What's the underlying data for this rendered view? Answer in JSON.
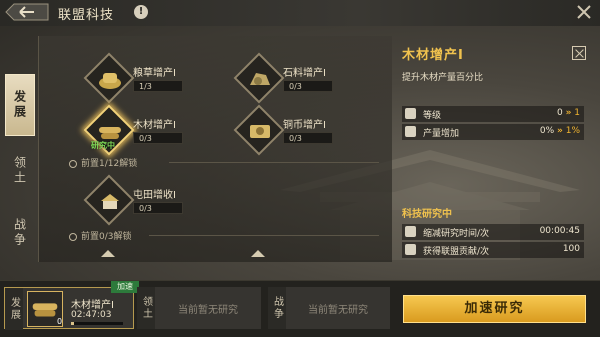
{
  "header": {
    "title": "联盟科技",
    "info_label": "!"
  },
  "side_tabs": [
    {
      "label": "发展",
      "active": true
    },
    {
      "label": "领土",
      "active": false
    },
    {
      "label": "战争",
      "active": false
    }
  ],
  "tree": {
    "nodes": [
      {
        "name": "粮草增产Ⅰ",
        "level": "1/3",
        "icon": "grain-icon"
      },
      {
        "name": "石料增产Ⅰ",
        "level": "0/3",
        "icon": "stone-icon"
      },
      {
        "name": "木材增产Ⅰ",
        "level": "0/3",
        "icon": "wood-icon",
        "status": "研究中"
      },
      {
        "name": "铜币增产Ⅰ",
        "level": "0/3",
        "icon": "coin-icon"
      },
      {
        "name": "屯田增收Ⅰ",
        "level": "0/3",
        "icon": "farm-icon"
      }
    ],
    "unlock_1": "前置1/12解锁",
    "unlock_2": "前置0/3解锁"
  },
  "detail": {
    "title": "木材增产Ⅰ",
    "description": "提升木材产量百分比",
    "stats": [
      {
        "label": "等级",
        "current": "0",
        "next": "1"
      },
      {
        "label": "产量增加",
        "current": "0%",
        "next": "1%"
      }
    ],
    "researching_heading": "科技研究中",
    "research_stats": [
      {
        "label": "缩减研究时间/次",
        "value": "00:00:45"
      },
      {
        "label": "获得联盟贡献/次",
        "value": "100"
      }
    ]
  },
  "queue": {
    "slot1": {
      "tab": "发展",
      "tag": "加速",
      "name": "木材增产Ⅰ",
      "time": "02:47:03",
      "count": "0",
      "progress": 0.05
    },
    "slot2": {
      "tab": "领土",
      "empty": "当前暂无研究"
    },
    "slot3": {
      "tab": "战争",
      "empty": "当前暂无研究"
    },
    "speed_button": "加速研究"
  },
  "colors": {
    "accent_gold": "#f0c24e",
    "researching_green": "#7ed957",
    "button_gold": "#e7b33a"
  }
}
